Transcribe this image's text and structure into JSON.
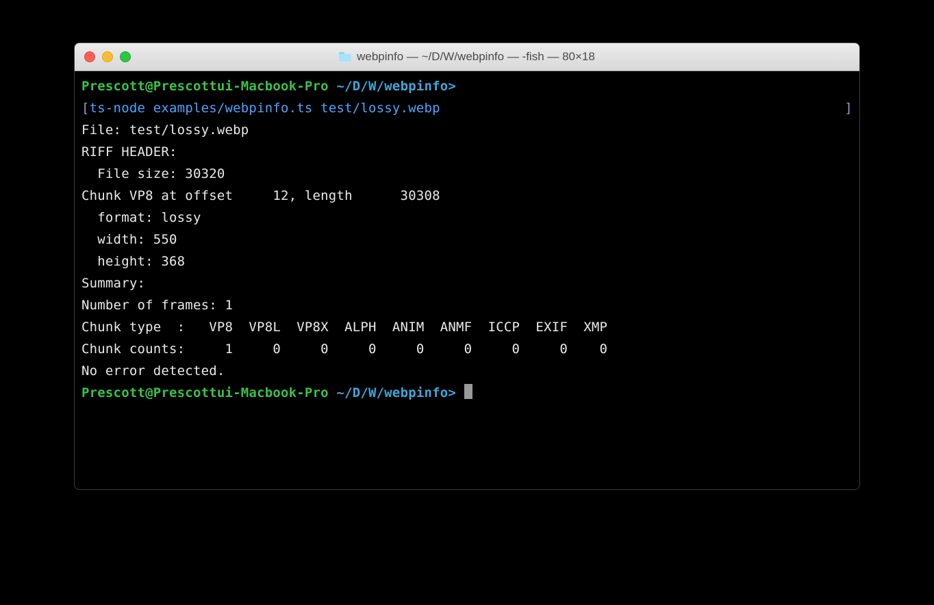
{
  "window": {
    "title": "webpinfo — ~/D/W/webpinfo — -fish — 80×18"
  },
  "prompt": {
    "user_host": "Prescott@Prescottui-Macbook-Pro",
    "path": "~/D/W/webpinfo",
    "arrow": ">"
  },
  "command": {
    "bracket_open": "[",
    "bracket_close": "]",
    "program": "ts-node",
    "args": "examples/webpinfo.ts test/lossy.webp"
  },
  "output": {
    "file_line": "File: test/lossy.webp",
    "riff_header": "RIFF HEADER:",
    "file_size_line": "  File size: 30320",
    "chunk_line": "Chunk VP8 at offset     12, length      30308",
    "format_line": "  format: lossy",
    "width_line": "  width: 550",
    "height_line": "  height: 368",
    "summary": "Summary:",
    "frames_line": "Number of frames: 1",
    "chunk_type_line": "Chunk type  :   VP8  VP8L  VP8X  ALPH  ANIM  ANMF  ICCP  EXIF  XMP",
    "chunk_count_line": "Chunk counts:     1     0     0     0     0     0     0     0    0",
    "no_error": "No error detected."
  }
}
